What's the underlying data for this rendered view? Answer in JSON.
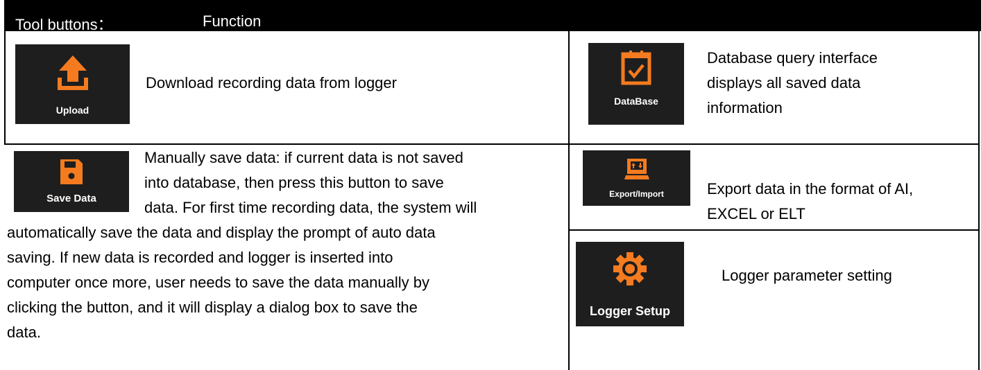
{
  "header": {
    "col1": "Tool buttons：",
    "col2": "Function"
  },
  "tools": [
    {
      "icon": "upload-icon",
      "label": "Upload",
      "description": "Download recording data from logger"
    },
    {
      "icon": "calendar-check-icon",
      "label": "DataBase",
      "description_lines": [
        "Database query interface",
        "displays all saved data",
        "information"
      ]
    },
    {
      "icon": "floppy-disk-icon",
      "label": "Save Data",
      "description_lines": [
        "Manually save data: if current data is not saved",
        "into database, then press this button to save",
        "data. For first time recording data, the system will",
        "automatically save the data and display the prompt of auto data",
        "saving. If new data is recorded and logger is inserted into",
        "computer once more, user needs to save the data manually by",
        "clicking the button, and it will display a dialog box to save the",
        "data."
      ]
    },
    {
      "icon": "export-import-icon",
      "label": "Export/Import",
      "description_lines": [
        "Export data in the format of AI,",
        "EXCEL or ELT"
      ]
    },
    {
      "icon": "gear-icon",
      "label": "Logger Setup",
      "description": "Logger parameter setting"
    }
  ],
  "colors": {
    "accent": "#f47b20",
    "button_bg": "#1e1e1e",
    "header_bg": "#000000"
  }
}
